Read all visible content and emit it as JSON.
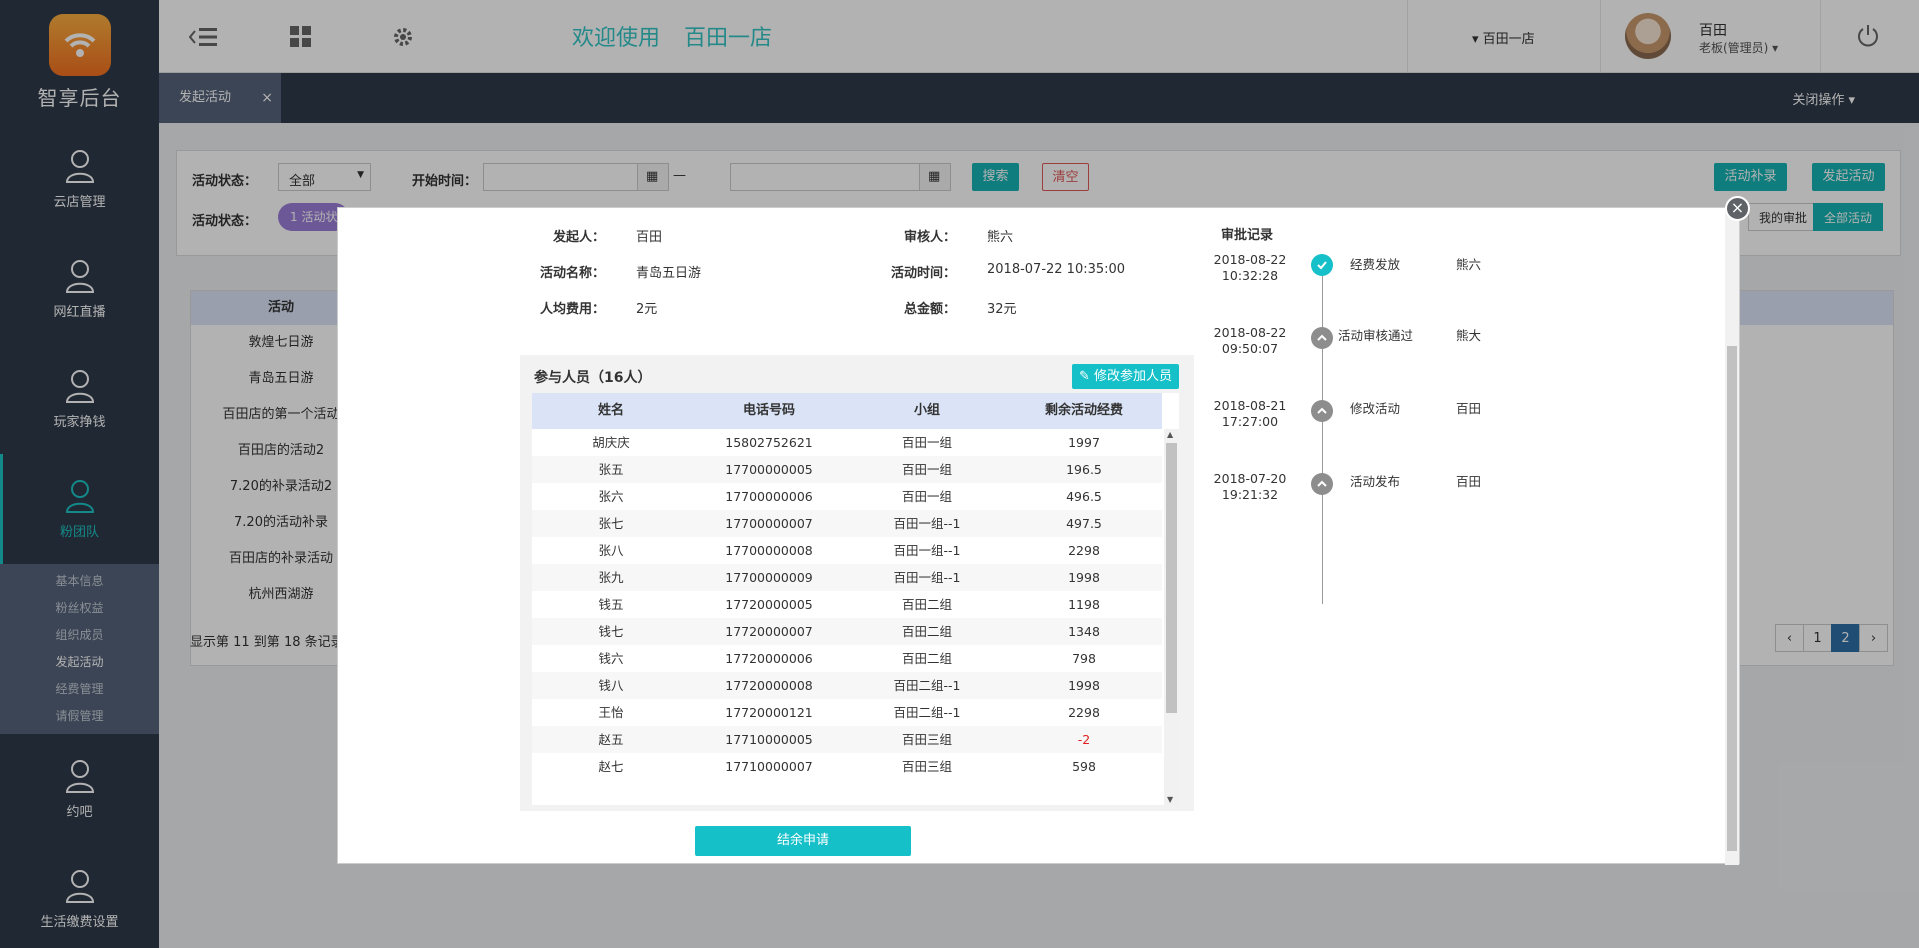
{
  "app": {
    "logo_text": "智享后台"
  },
  "sidebar": {
    "items": [
      {
        "label": "云店管理"
      },
      {
        "label": "网红直播"
      },
      {
        "label": "玩家挣钱"
      },
      {
        "label": "粉团队"
      },
      {
        "label": "约吧"
      },
      {
        "label": "生活缴费设置"
      }
    ],
    "subitems": [
      {
        "label": "基本信息"
      },
      {
        "label": "粉丝权益"
      },
      {
        "label": "组织成员"
      },
      {
        "label": "发起活动"
      },
      {
        "label": "经费管理"
      },
      {
        "label": "请假管理"
      }
    ]
  },
  "header": {
    "welcome": "欢迎使用",
    "store": "百田一店",
    "store_select": "▾ 百田一店",
    "user_name": "百田",
    "user_role": "老板(管理员) ▾"
  },
  "tabs": {
    "active_label": "发起活动",
    "close_ops": "关闭操作 ▾"
  },
  "filters": {
    "status_label": "活动状态：",
    "status_value": "全部",
    "start_label": "开始时间：",
    "dash": "—",
    "search_btn": "搜索",
    "clear_btn": "清空",
    "status2_label": "活动状态：",
    "status_pill": "1 活动状",
    "supplement_btn": "活动补录",
    "launch_btn": "发起活动",
    "my_approval": "我的审批",
    "all_activity": "全部活动"
  },
  "bg_table": {
    "header": "活动",
    "rows": [
      "敦煌七日游",
      "青岛五日游",
      "百田店的第一个活动",
      "百田店的活动2",
      "7.20的补录活动2",
      "7.20的活动补录",
      "百田店的补录活动",
      "杭州西湖游"
    ],
    "footer": "显示第 11 到第 18 条记录",
    "pager": {
      "prev": "‹",
      "p1": "1",
      "p2": "2",
      "next": "›"
    }
  },
  "modal": {
    "close": "×",
    "info": {
      "initiator_label": "发起人：",
      "initiator": "百田",
      "reviewer_label": "审核人：",
      "reviewer": "熊六",
      "name_label": "活动名称：",
      "name": "青岛五日游",
      "time_label": "活动时间：",
      "time": "2018-07-22 10:35:00",
      "per_label": "人均费用：",
      "per": "2元",
      "total_label": "总金额：",
      "total": "32元"
    },
    "participants": {
      "title": "参与人员（16人）",
      "edit_btn": "修改参加人员",
      "columns": [
        "姓名",
        "电话号码",
        "小组",
        "剩余活动经费"
      ],
      "rows": [
        [
          "胡庆庆",
          "15802752621",
          "百田一组",
          "1997"
        ],
        [
          "张五",
          "17700000005",
          "百田一组",
          "196.5"
        ],
        [
          "张六",
          "17700000006",
          "百田一组",
          "496.5"
        ],
        [
          "张七",
          "17700000007",
          "百田一组--1",
          "497.5"
        ],
        [
          "张八",
          "17700000008",
          "百田一组--1",
          "2298"
        ],
        [
          "张九",
          "17700000009",
          "百田一组--1",
          "1998"
        ],
        [
          "钱五",
          "17720000005",
          "百田二组",
          "1198"
        ],
        [
          "钱七",
          "17720000007",
          "百田二组",
          "1348"
        ],
        [
          "钱六",
          "17720000006",
          "百田二组",
          "798"
        ],
        [
          "钱八",
          "17720000008",
          "百田二组--1",
          "1998"
        ],
        [
          "王怡",
          "17720000121",
          "百田二组--1",
          "2298"
        ],
        [
          "赵五",
          "17710000005",
          "百田三组",
          "-2"
        ],
        [
          "赵七",
          "17710000007",
          "百田三组",
          "598"
        ]
      ]
    },
    "settle_btn": "结余申请",
    "audit": {
      "title": "审批记录",
      "records": [
        {
          "date": "2018-08-22",
          "time": "10:32:28",
          "action": "经费发放",
          "user": "熊六",
          "done": true
        },
        {
          "date": "2018-08-22",
          "time": "09:50:07",
          "action": "活动审核通过",
          "user": "熊大",
          "done": false
        },
        {
          "date": "2018-08-21",
          "time": "17:27:00",
          "action": "修改活动",
          "user": "百田",
          "done": false
        },
        {
          "date": "2018-07-20",
          "time": "19:21:32",
          "action": "活动发布",
          "user": "百田",
          "done": false
        }
      ]
    }
  },
  "colors": {
    "accent": "#16c0c8",
    "sidebar_bg": "#2f3a4a",
    "table_head": "#dbe4f7",
    "negative": "#e02020"
  }
}
